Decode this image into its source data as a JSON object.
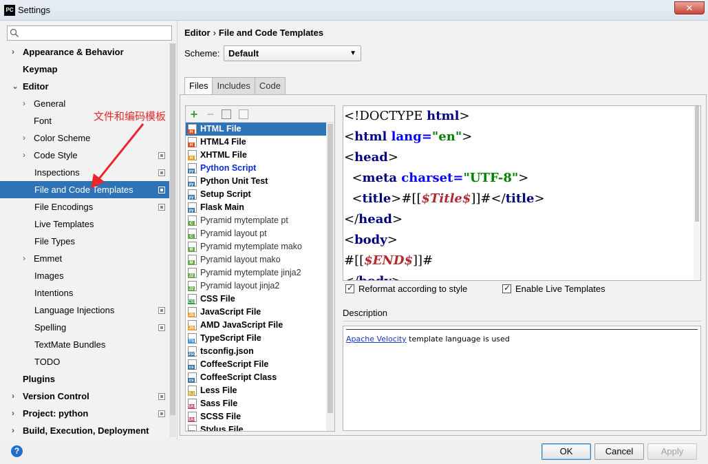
{
  "window": {
    "title": "Settings",
    "app_icon": "PC"
  },
  "search": {
    "placeholder": ""
  },
  "tree": [
    {
      "label": "Appearance & Behavior",
      "bold": true,
      "arrow": "›",
      "indent": 0
    },
    {
      "label": "Keymap",
      "bold": true,
      "arrow": "",
      "indent": 0
    },
    {
      "label": "Editor",
      "bold": true,
      "arrow": "⌄",
      "indent": 0
    },
    {
      "label": "General",
      "bold": false,
      "arrow": "›",
      "indent": 1
    },
    {
      "label": "Font",
      "bold": false,
      "arrow": "",
      "indent": 1
    },
    {
      "label": "Color Scheme",
      "bold": false,
      "arrow": "›",
      "indent": 1
    },
    {
      "label": "Code Style",
      "bold": false,
      "arrow": "›",
      "indent": 1,
      "icon": true
    },
    {
      "label": "Inspections",
      "bold": false,
      "arrow": "",
      "indent": 2,
      "icon": true
    },
    {
      "label": "File and Code Templates",
      "bold": false,
      "arrow": "",
      "indent": 2,
      "icon": true,
      "selected": true
    },
    {
      "label": "File Encodings",
      "bold": false,
      "arrow": "",
      "indent": 2,
      "icon": true
    },
    {
      "label": "Live Templates",
      "bold": false,
      "arrow": "",
      "indent": 2
    },
    {
      "label": "File Types",
      "bold": false,
      "arrow": "",
      "indent": 2
    },
    {
      "label": "Emmet",
      "bold": false,
      "arrow": "›",
      "indent": 1
    },
    {
      "label": "Images",
      "bold": false,
      "arrow": "",
      "indent": 2
    },
    {
      "label": "Intentions",
      "bold": false,
      "arrow": "",
      "indent": 2
    },
    {
      "label": "Language Injections",
      "bold": false,
      "arrow": "",
      "indent": 2,
      "icon": true
    },
    {
      "label": "Spelling",
      "bold": false,
      "arrow": "",
      "indent": 2,
      "icon": true
    },
    {
      "label": "TextMate Bundles",
      "bold": false,
      "arrow": "",
      "indent": 2
    },
    {
      "label": "TODO",
      "bold": false,
      "arrow": "",
      "indent": 2
    },
    {
      "label": "Plugins",
      "bold": true,
      "arrow": "",
      "indent": 0
    },
    {
      "label": "Version Control",
      "bold": true,
      "arrow": "›",
      "indent": 0,
      "icon": true
    },
    {
      "label": "Project: python",
      "bold": true,
      "arrow": "›",
      "indent": 0,
      "icon": true
    },
    {
      "label": "Build, Execution, Deployment",
      "bold": true,
      "arrow": "›",
      "indent": 0
    }
  ],
  "annotation": "文件和编码模板",
  "breadcrumb": {
    "parent": "Editor",
    "separator": "›",
    "current": "File and Code Templates"
  },
  "scheme": {
    "label": "Scheme:",
    "value": "Default"
  },
  "tabs": [
    {
      "label": "Files",
      "active": true
    },
    {
      "label": "Includes",
      "active": false
    },
    {
      "label": "Code",
      "active": false
    }
  ],
  "toolbar": {
    "add": "+",
    "remove": "−"
  },
  "templates": [
    {
      "label": "HTML File",
      "icon": "H",
      "color": "#e44d26",
      "style": "selected"
    },
    {
      "label": "HTML4 File",
      "icon": "H",
      "color": "#e44d26",
      "style": "bold"
    },
    {
      "label": "XHTML File",
      "icon": "H",
      "color": "#e8a32e",
      "style": "bold"
    },
    {
      "label": "Python Script",
      "icon": "py",
      "color": "#3572a5",
      "style": "blue"
    },
    {
      "label": "Python Unit Test",
      "icon": "py",
      "color": "#3572a5",
      "style": "bold"
    },
    {
      "label": "Setup Script",
      "icon": "py",
      "color": "#3572a5",
      "style": "bold"
    },
    {
      "label": "Flask Main",
      "icon": "py",
      "color": "#3572a5",
      "style": "bold"
    },
    {
      "label": "Pyramid mytemplate pt",
      "icon": "C",
      "color": "#6aa84f",
      "style": "normal"
    },
    {
      "label": "Pyramid layout pt",
      "icon": "C",
      "color": "#6aa84f",
      "style": "normal"
    },
    {
      "label": "Pyramid mytemplate mako",
      "icon": "M",
      "color": "#6aa84f",
      "style": "normal"
    },
    {
      "label": "Pyramid layout mako",
      "icon": "M",
      "color": "#6aa84f",
      "style": "normal"
    },
    {
      "label": "Pyramid mytemplate jinja2",
      "icon": "J2",
      "color": "#6aa84f",
      "style": "normal"
    },
    {
      "label": "Pyramid layout jinja2",
      "icon": "J2",
      "color": "#6aa84f",
      "style": "normal"
    },
    {
      "label": "CSS File",
      "icon": "CSS",
      "color": "#2a9f4a",
      "style": "bold"
    },
    {
      "label": "JavaScript File",
      "icon": "JS",
      "color": "#e8a32e",
      "style": "bold"
    },
    {
      "label": "AMD JavaScript File",
      "icon": "JS",
      "color": "#e8a32e",
      "style": "bold"
    },
    {
      "label": "TypeScript File",
      "icon": "TS",
      "color": "#3b8fd6",
      "style": "bold"
    },
    {
      "label": "tsconfig.json",
      "icon": "JSON",
      "color": "#3b6fa0",
      "style": "bold"
    },
    {
      "label": "CoffeeScript File",
      "icon": "cs",
      "color": "#3572a5",
      "style": "bold"
    },
    {
      "label": "CoffeeScript Class",
      "icon": "cs",
      "color": "#3572a5",
      "style": "bold"
    },
    {
      "label": "Less File",
      "icon": "{L}",
      "color": "#c9a02a",
      "style": "bold"
    },
    {
      "label": "Sass File",
      "icon": "SASS",
      "color": "#c54b7a",
      "style": "bold"
    },
    {
      "label": "SCSS File",
      "icon": "SASS",
      "color": "#c54b7a",
      "style": "bold"
    },
    {
      "label": "Stylus File",
      "icon": "S",
      "color": "#888888",
      "style": "bold"
    }
  ],
  "editor": {
    "lines": [
      [
        {
          "t": "<!DOCTYPE ",
          "c": ""
        },
        {
          "t": "html",
          "c": "tag"
        },
        {
          "t": ">",
          "c": ""
        }
      ],
      [
        {
          "t": "<",
          "c": ""
        },
        {
          "t": "html ",
          "c": "tag"
        },
        {
          "t": "lang=",
          "c": "attr"
        },
        {
          "t": "\"en\"",
          "c": "str"
        },
        {
          "t": ">",
          "c": ""
        }
      ],
      [
        {
          "t": "<",
          "c": ""
        },
        {
          "t": "head",
          "c": "tag"
        },
        {
          "t": ">",
          "c": ""
        }
      ],
      [
        {
          "t": "  <",
          "c": ""
        },
        {
          "t": "meta ",
          "c": "tag"
        },
        {
          "t": "charset=",
          "c": "attr"
        },
        {
          "t": "\"UTF-8\"",
          "c": "str"
        },
        {
          "t": ">",
          "c": ""
        }
      ],
      [
        {
          "t": "  <",
          "c": ""
        },
        {
          "t": "title",
          "c": "tag"
        },
        {
          "t": ">#[[",
          "c": ""
        },
        {
          "t": "$Title$",
          "c": "var"
        },
        {
          "t": "]]#</",
          "c": ""
        },
        {
          "t": "title",
          "c": "tag"
        },
        {
          "t": ">",
          "c": ""
        }
      ],
      [
        {
          "t": "</",
          "c": ""
        },
        {
          "t": "head",
          "c": "tag"
        },
        {
          "t": ">",
          "c": ""
        }
      ],
      [
        {
          "t": "<",
          "c": ""
        },
        {
          "t": "body",
          "c": "tag"
        },
        {
          "t": ">",
          "c": ""
        }
      ],
      [
        {
          "t": "#[[",
          "c": ""
        },
        {
          "t": "$END$",
          "c": "var"
        },
        {
          "t": "]]#",
          "c": ""
        }
      ],
      [
        {
          "t": "</",
          "c": ""
        },
        {
          "t": "body",
          "c": "tag"
        },
        {
          "t": ">",
          "c": ""
        }
      ]
    ]
  },
  "options": {
    "reformat": {
      "label": "Reformat according to style",
      "checked": true
    },
    "live_templates": {
      "label": "Enable Live Templates",
      "checked": true
    }
  },
  "description": {
    "label": "Description",
    "link": "Apache Velocity",
    "text": " template language is used"
  },
  "buttons": {
    "help": "?",
    "ok": "OK",
    "cancel": "Cancel",
    "apply": "Apply"
  }
}
